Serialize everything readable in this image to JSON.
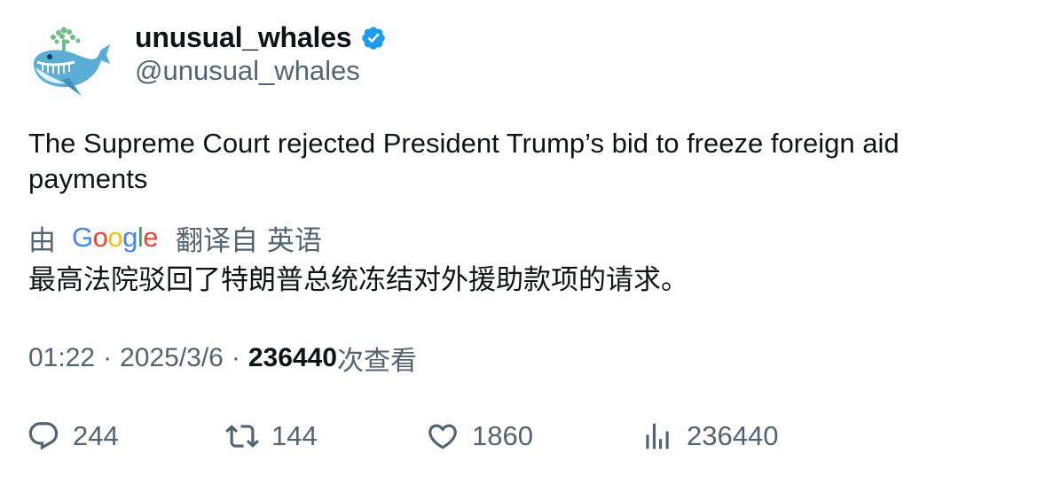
{
  "author": {
    "display_name": "unusual_whales",
    "handle": "@unusual_whales",
    "verified": true,
    "avatar_icon": "whale-avatar-icon"
  },
  "tweet": {
    "text": "The Supreme Court rejected President Trump’s bid to freeze foreign aid payments"
  },
  "translation": {
    "prefix": "由",
    "provider": "Google",
    "suffix": "翻译自 英语",
    "text": "最高法院驳回了特朗普总统冻结对外援助款项的请求。"
  },
  "meta": {
    "time": "01:22",
    "date": "2025/3/6",
    "separator": "·",
    "views_count": "236440",
    "views_suffix": "次查看"
  },
  "actions": {
    "replies": "244",
    "retweets": "144",
    "likes": "1860",
    "views": "236440"
  },
  "colors": {
    "text_primary": "#0f1419",
    "text_secondary": "#536471",
    "verified_blue": "#1d9bf0",
    "google_blue": "#4285f4",
    "google_red": "#ea4335",
    "google_yellow": "#fbbc05",
    "google_green": "#34a853"
  }
}
